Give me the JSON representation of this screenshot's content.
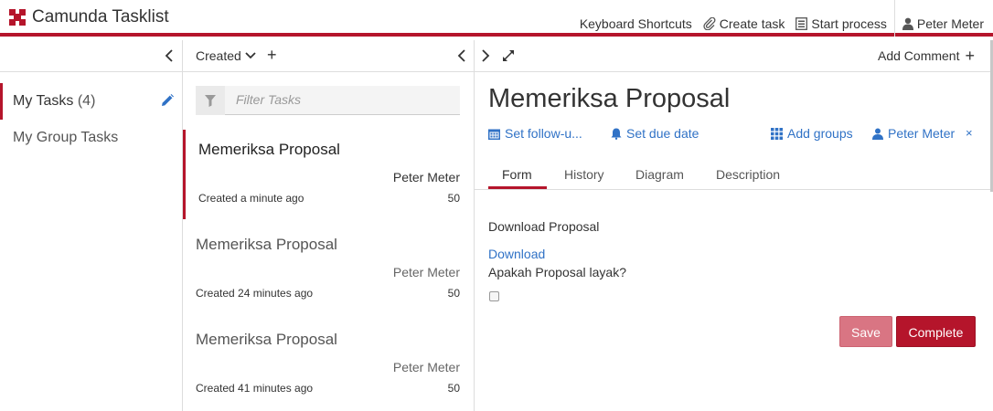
{
  "app": {
    "title": "Camunda Tasklist"
  },
  "colors": {
    "accent": "#b5152b",
    "link": "#3072c6",
    "save_bg": "#d97583"
  },
  "header_nav": {
    "keyboard_shortcuts": "Keyboard Shortcuts",
    "create_task": "Create task",
    "start_process": "Start process",
    "user": "Peter Meter"
  },
  "filters": [
    {
      "label": "My Tasks",
      "count": "(4)"
    },
    {
      "label": "My Group Tasks"
    }
  ],
  "list": {
    "sort_label": "Created",
    "search_placeholder": "Filter Tasks",
    "tasks": [
      {
        "name": "Memeriksa Proposal",
        "assignee": "Peter Meter",
        "created": "Created a minute ago",
        "priority": "50"
      },
      {
        "name": "Memeriksa Proposal",
        "assignee": "Peter Meter",
        "created": "Created 24 minutes ago",
        "priority": "50"
      },
      {
        "name": "Memeriksa Proposal",
        "assignee": "Peter Meter",
        "created": "Created 41 minutes ago",
        "priority": "50"
      }
    ]
  },
  "task": {
    "add_comment": "Add Comment",
    "title": "Memeriksa Proposal",
    "follow_up": "Set follow-u...",
    "due_date": "Set due date",
    "add_groups": "Add groups",
    "assignee": "Peter Meter",
    "remove_assignee": "×",
    "tabs": [
      "Form",
      "History",
      "Diagram",
      "Description"
    ],
    "form": {
      "download_label": "Download Proposal",
      "download_link": "Download",
      "question": "Apakah Proposal layak?",
      "save": "Save",
      "complete": "Complete"
    }
  }
}
